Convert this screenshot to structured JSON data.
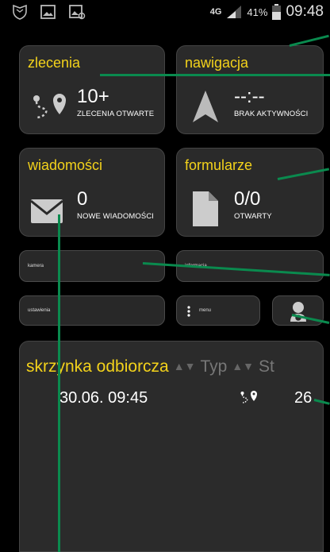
{
  "status_bar": {
    "network": "4G",
    "battery_percent": "41%",
    "time": "09:48",
    "icons": [
      "shield-icon",
      "image-icon",
      "image-settings-icon",
      "signal-icon",
      "battery-icon"
    ]
  },
  "tiles": {
    "orders": {
      "title": "zlecenia",
      "value": "10+",
      "caption": "ZLECENIA OTWARTE",
      "icon": "route-pin-icon"
    },
    "navigation": {
      "title": "nawigacja",
      "value": "--:--",
      "caption": "BRAK AKTYWNOŚCI",
      "icon": "navigation-arrow-icon"
    },
    "messages": {
      "title": "wiadomości",
      "value": "0",
      "caption": "NOWE WIADOMOŚCI",
      "icon": "envelope-icon"
    },
    "forms": {
      "title": "formularze",
      "value": "0/0",
      "caption": "OTWARTY",
      "icon": "document-icon"
    }
  },
  "buttons": {
    "camera": "kamera",
    "information": "informacja",
    "settings": "ustawienia",
    "menu": "menu",
    "driver_icon": "driver-avatar-icon"
  },
  "inbox": {
    "title": "skrzynka odbiorcza",
    "columns": [
      "Typ",
      "St"
    ],
    "rows": [
      {
        "date": "30.06. 09:45",
        "type_icon": "route-pin-icon",
        "status": "26"
      }
    ]
  },
  "colors": {
    "accent": "#f3d21b",
    "annotation": "#0a8a4e",
    "tile_bg": "#2a2a2a"
  }
}
